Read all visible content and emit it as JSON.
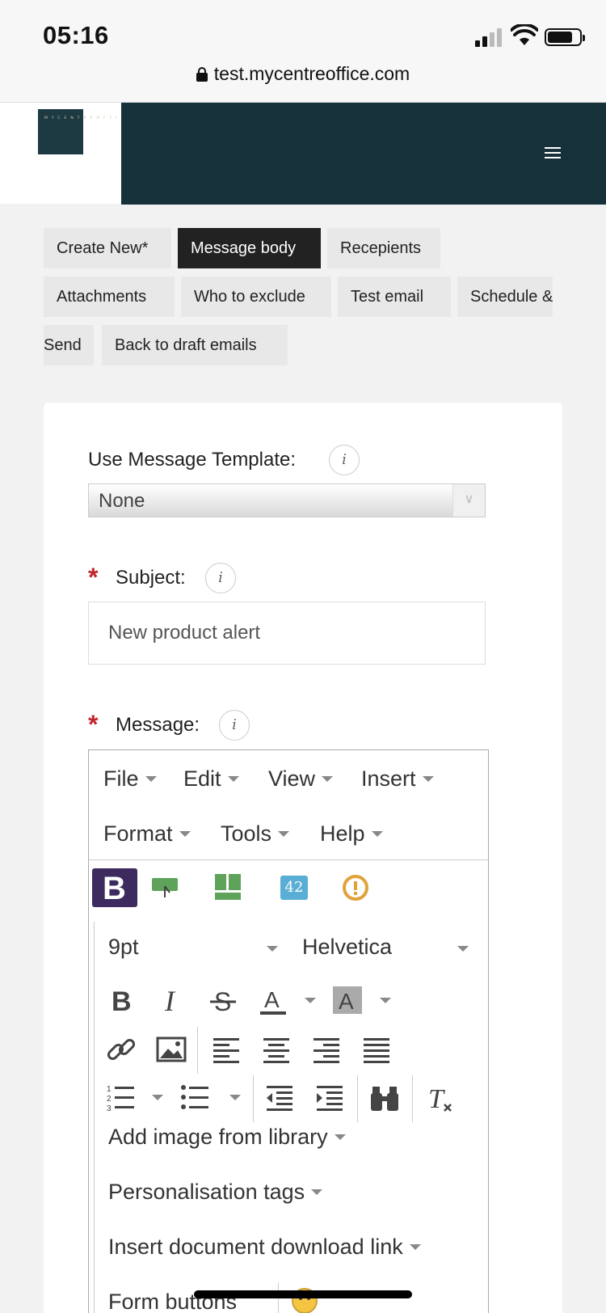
{
  "status_bar": {
    "time": "05:16"
  },
  "browser": {
    "url": "test.mycentreoffice.com"
  },
  "logo": {
    "text": "MYCENTREOFFICE"
  },
  "tabs": [
    {
      "label": "Create New*"
    },
    {
      "label": "Message body",
      "active": true
    },
    {
      "label": "Recepients"
    },
    {
      "label": "Attachments"
    },
    {
      "label": "Who to exclude"
    },
    {
      "label": "Test email"
    },
    {
      "label": "Schedule &"
    },
    {
      "label": "Send"
    },
    {
      "label": "Back to draft emails"
    }
  ],
  "form": {
    "template_label": "Use Message Template:",
    "template_value": "None",
    "subject_label": "Subject:",
    "subject_value": "New product alert",
    "message_label": "Message:",
    "info_glyph": "i",
    "required_glyph": "*"
  },
  "editor": {
    "menubar": [
      "File",
      "Edit",
      "View",
      "Insert",
      "Format",
      "Tools",
      "Help"
    ],
    "plugin_badges": {
      "bold_letter": "B",
      "number_badge": "42"
    },
    "font_size": "9pt",
    "font_family": "Helvetica",
    "dropdowns": {
      "add_image": "Add image from library",
      "personalisation": "Personalisation tags",
      "doc_link": "Insert document download link",
      "form_buttons": "Form buttons"
    }
  },
  "colors": {
    "header_dark": "#17313a",
    "active_tab": "#222222",
    "required": "#c0272d",
    "badge_purple": "#3d2a5e",
    "badge_green": "#5fa35b",
    "badge_blue": "#5aaed5",
    "badge_orange": "#e1a23a"
  }
}
